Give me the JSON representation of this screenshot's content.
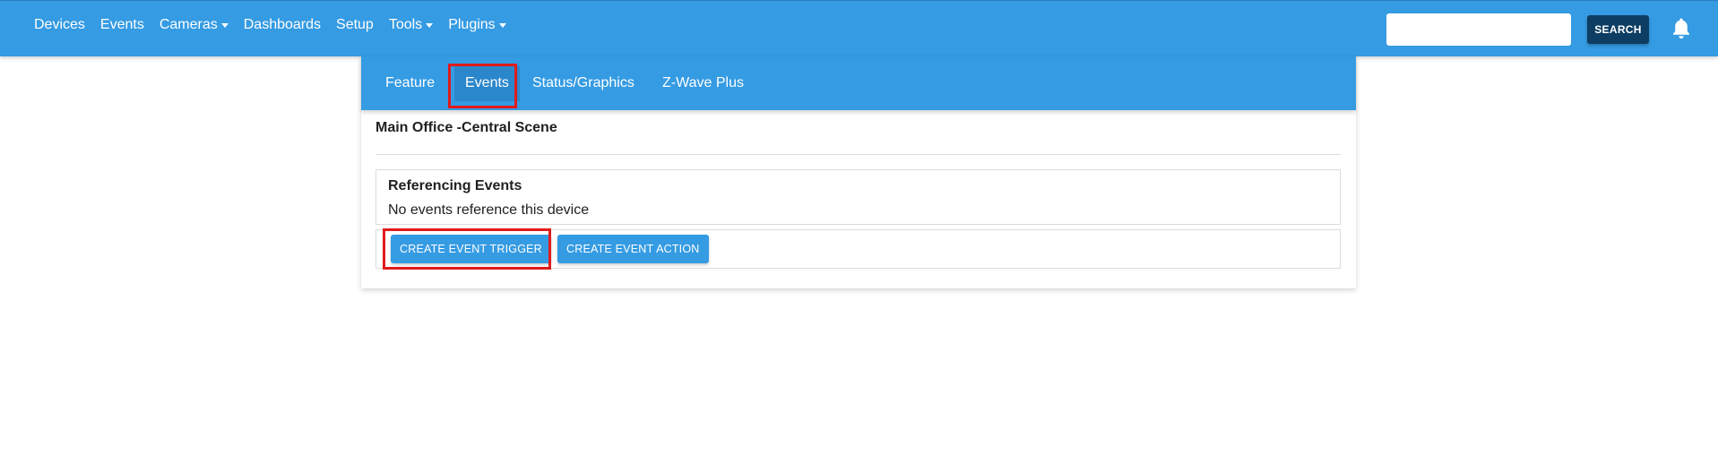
{
  "navbar": {
    "items": [
      {
        "label": "Devices",
        "dropdown": false
      },
      {
        "label": "Events",
        "dropdown": false
      },
      {
        "label": "Cameras",
        "dropdown": true
      },
      {
        "label": "Dashboards",
        "dropdown": false
      },
      {
        "label": "Setup",
        "dropdown": false
      },
      {
        "label": "Tools",
        "dropdown": true
      },
      {
        "label": "Plugins",
        "dropdown": true
      }
    ],
    "search_value": "",
    "search_placeholder": "",
    "search_label": "SEARCH",
    "notification_icon": "bell-icon"
  },
  "tabs": [
    {
      "label": "Feature",
      "active": false
    },
    {
      "label": "Events",
      "active": true
    },
    {
      "label": "Status/Graphics",
      "active": false
    },
    {
      "label": "Z-Wave Plus",
      "active": false
    }
  ],
  "device": {
    "title": "Main Office -Central Scene"
  },
  "referencing": {
    "title": "Referencing Events",
    "message": "No events reference this device"
  },
  "actions": {
    "create_trigger_label": "CREATE EVENT TRIGGER",
    "create_action_label": "CREATE EVENT ACTION"
  },
  "colors": {
    "primary": "#359be3",
    "search_button": "#0d3d62",
    "highlight": "#e01b1b"
  }
}
